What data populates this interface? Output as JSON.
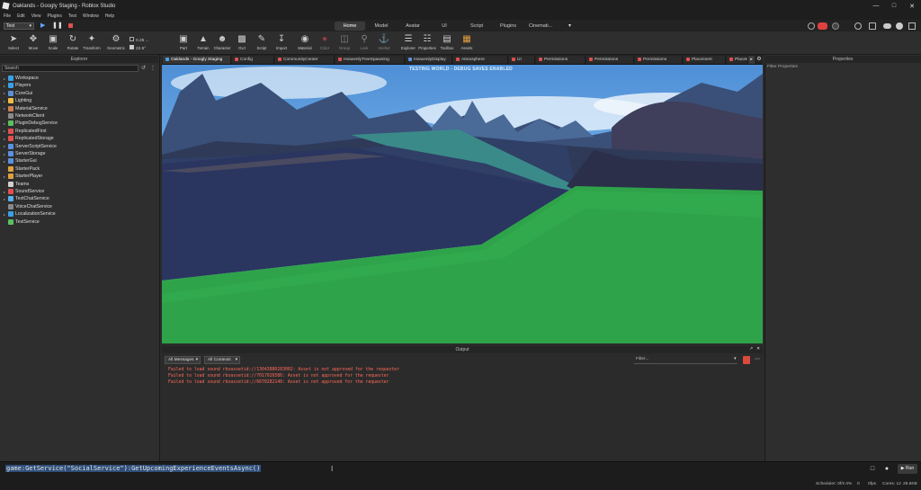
{
  "window": {
    "title": "Oaklands - Googly Staging - Roblox Studio"
  },
  "menu": [
    "File",
    "Edit",
    "View",
    "Plugins",
    "Test",
    "Window",
    "Help"
  ],
  "mode_select": "Test",
  "ribbon_tabs": [
    {
      "label": "Home",
      "active": true
    },
    {
      "label": "Model",
      "active": false
    },
    {
      "label": "Avatar",
      "active": false
    },
    {
      "label": "UI",
      "active": false
    },
    {
      "label": "Script",
      "active": false
    },
    {
      "label": "Plugins",
      "active": false
    },
    {
      "label": "Cinemati...",
      "active": false
    }
  ],
  "tools": [
    {
      "label": "Select",
      "icon": "cursor-icon"
    },
    {
      "label": "Move",
      "icon": "move-icon"
    },
    {
      "label": "Scale",
      "icon": "scale-icon"
    },
    {
      "label": "Rotate",
      "icon": "rotate-icon"
    },
    {
      "label": "Transform",
      "icon": "transform-icon"
    },
    {
      "label": "Geometric",
      "icon": "geometric-icon"
    },
    {
      "label": "Part",
      "icon": "part-icon"
    },
    {
      "label": "Terrain",
      "icon": "terrain-icon"
    },
    {
      "label": "Character",
      "icon": "character-icon"
    },
    {
      "label": "GUI",
      "icon": "gui-icon"
    },
    {
      "label": "Script",
      "icon": "script-icon"
    },
    {
      "label": "Import",
      "icon": "import-icon"
    },
    {
      "label": "Material",
      "icon": "material-icon"
    },
    {
      "label": "Color",
      "icon": "color-icon"
    },
    {
      "label": "Group",
      "icon": "group-icon"
    },
    {
      "label": "Lock",
      "icon": "lock-icon"
    },
    {
      "label": "Anchor",
      "icon": "anchor-icon"
    },
    {
      "label": "Explorer",
      "icon": "explorer-icon"
    },
    {
      "label": "Properties",
      "icon": "properties-icon"
    },
    {
      "label": "Toolbox",
      "icon": "toolbox-icon"
    },
    {
      "label": "Assets",
      "icon": "assets-icon"
    }
  ],
  "snap": {
    "move": "0.25 ...",
    "rotate": "22.5°"
  },
  "explorer": {
    "title": "Explorer",
    "search_placeholder": "Search",
    "items": [
      {
        "label": "Workspace",
        "color": "#3aa0e8"
      },
      {
        "label": "Players",
        "color": "#3aa0e8"
      },
      {
        "label": "CoreGui",
        "color": "#5a8fd8"
      },
      {
        "label": "Lighting",
        "color": "#f0c040"
      },
      {
        "label": "MaterialService",
        "color": "#d08050"
      },
      {
        "label": "NetworkClient",
        "color": "#888888"
      },
      {
        "label": "PluginDebugService",
        "color": "#5ac060"
      },
      {
        "label": "ReplicatedFirst",
        "color": "#e05050"
      },
      {
        "label": "ReplicatedStorage",
        "color": "#e05050"
      },
      {
        "label": "ServerScriptService",
        "color": "#5a90e0"
      },
      {
        "label": "ServerStorage",
        "color": "#5a90e0"
      },
      {
        "label": "StarterGui",
        "color": "#5a90e0"
      },
      {
        "label": "StarterPack",
        "color": "#e0a040"
      },
      {
        "label": "StarterPlayer",
        "color": "#e0a040"
      },
      {
        "label": "Teams",
        "color": "#d0d0d0"
      },
      {
        "label": "SoundService",
        "color": "#e05050"
      },
      {
        "label": "TextChatService",
        "color": "#5ab0f0"
      },
      {
        "label": "VoiceChatService",
        "color": "#888888"
      },
      {
        "label": "LocalizationService",
        "color": "#3aa0e8"
      },
      {
        "label": "TestService",
        "color": "#5ac060"
      }
    ]
  },
  "doc_tabs": [
    {
      "label": "Oaklands - Googly Staging",
      "color": "#4aa0e8"
    },
    {
      "label": "Config",
      "color": "#e05050"
    },
    {
      "label": "CommunityCenter",
      "color": "#e05050"
    },
    {
      "label": "HeavenlyTreeSpawning",
      "color": "#e05050"
    },
    {
      "label": "HeavenlyDisplay",
      "color": "#5a90e0"
    },
    {
      "label": "Atmosphere",
      "color": "#e05050"
    },
    {
      "label": "UI",
      "color": "#e05050"
    },
    {
      "label": "Permissions",
      "color": "#e05050"
    },
    {
      "label": "Permissions",
      "color": "#e05050"
    },
    {
      "label": "Permissions",
      "color": "#e05050"
    },
    {
      "label": "Placement",
      "color": "#e05050"
    },
    {
      "label": "Placem",
      "color": "#e05050"
    }
  ],
  "viewport": {
    "banner": "TESTING WORLD - DEBUG SAVES ENABLED"
  },
  "output": {
    "title": "Output",
    "filter_messages": "All Messages",
    "filter_contexts": "All Contexts",
    "filter_placeholder": "Filter...",
    "lines": [
      "Failed to load sound rbxassetid://13643880283002: Asset is not approved for the requester",
      "Failed to load sound rbxassetid://7017026586: Asset is not approved for the requester",
      "Failed to load sound rbxassetid://6670282140: Asset is not approved for the requester"
    ]
  },
  "properties": {
    "title": "Properties",
    "filter_placeholder": "Filter Properties"
  },
  "command": {
    "text": "game:GetService(\"SocialService\"):GetUpcomingExperienceEventsAsync()",
    "run_label": "Run"
  },
  "status": {
    "scheduler": "Scheduler: 0f/s 0%",
    "t": "0",
    "fps": "0fps",
    "cores": "Cores: 12",
    "mem": "29.6KB"
  }
}
